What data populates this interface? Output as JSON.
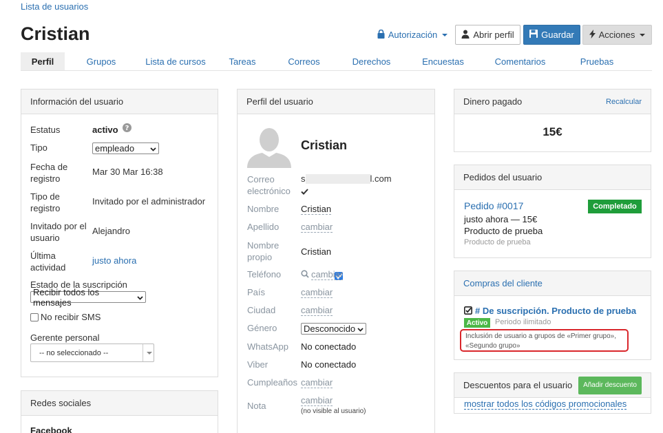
{
  "breadcrumb": "Lista de usuarios",
  "title": "Cristian",
  "header_buttons": {
    "authorization": "Autorización",
    "open_profile": "Abrir perfil",
    "save": "Guardar",
    "actions": "Acciones"
  },
  "tabs": [
    "Perfil",
    "Grupos",
    "Lista de cursos",
    "Tareas",
    "Correos",
    "Derechos",
    "Encuestas",
    "Comentarios",
    "Pruebas"
  ],
  "user_info": {
    "heading": "Información del usuario",
    "status_label": "Estatus",
    "status_value": "activo",
    "type_label": "Tipo",
    "type_value": "empleado",
    "reg_date_label": "Fecha de registro",
    "reg_date_value": "Mar 30 Mar 16:38",
    "reg_type_label": "Tipo de registro",
    "reg_type_value": "Invitado por el administrador",
    "invited_by_label": "Invitado por el usuario",
    "invited_by_value": "Alejandro",
    "last_activity_label": "Última actividad",
    "last_activity_value": "justo ahora",
    "subscription_label": "Estado de la suscripción",
    "subscription_value": "Recibir todos los mensajes",
    "no_sms_label": "No recibir SMS",
    "manager_label": "Gerente personal",
    "manager_value": "-- no seleccionado --"
  },
  "social": {
    "heading": "Redes sociales",
    "facebook": "Facebook"
  },
  "profile": {
    "heading": "Perfil del usuario",
    "name": "Cristian",
    "email_label": "Correo electrónico",
    "email_prefix": "s",
    "email_suffix": "l.com",
    "first_name_label": "Nombre",
    "first_name_value": "Cristian",
    "last_name_label": "Apellido",
    "change": "cambiar",
    "own_name_label": "Nombre propio",
    "own_name_value": "Cristian",
    "phone_label": "Teléfono",
    "country_label": "País",
    "city_label": "Ciudad",
    "gender_label": "Género",
    "gender_value": "Desconocido",
    "whatsapp_label": "WhatsApp",
    "whatsapp_value": "No conectado",
    "viber_label": "Viber",
    "viber_value": "No conectado",
    "birthday_label": "Cumpleaños",
    "note_label": "Nota",
    "note_hint": "(no visible al usuario)"
  },
  "money": {
    "heading": "Dinero pagado",
    "recalc": "Recalcular",
    "amount": "15€"
  },
  "orders": {
    "heading": "Pedidos del usuario",
    "order_id": "Pedido #0017",
    "status": "Completado",
    "time_price": "justo ahora — 15€",
    "product": "Producto de prueba",
    "product_small": "Producto de prueba"
  },
  "purchases": {
    "heading": "Compras del cliente",
    "title": "# De suscripción. Producto de prueba",
    "badge": "Activo",
    "period": "Periodo ilimitado",
    "note": "Inclusión de usuario a grupos de «Primer grupo», «Segundo grupo»"
  },
  "discounts": {
    "heading": "Descuentos para el usuario",
    "add_button": "Añadir descuento",
    "show_all": "mostrar todos los códigos promocionales"
  },
  "colors": {
    "link": "#2a6fb0",
    "primary": "#337ab7",
    "success": "#1f9d3a",
    "highlight": "#d9262b"
  }
}
